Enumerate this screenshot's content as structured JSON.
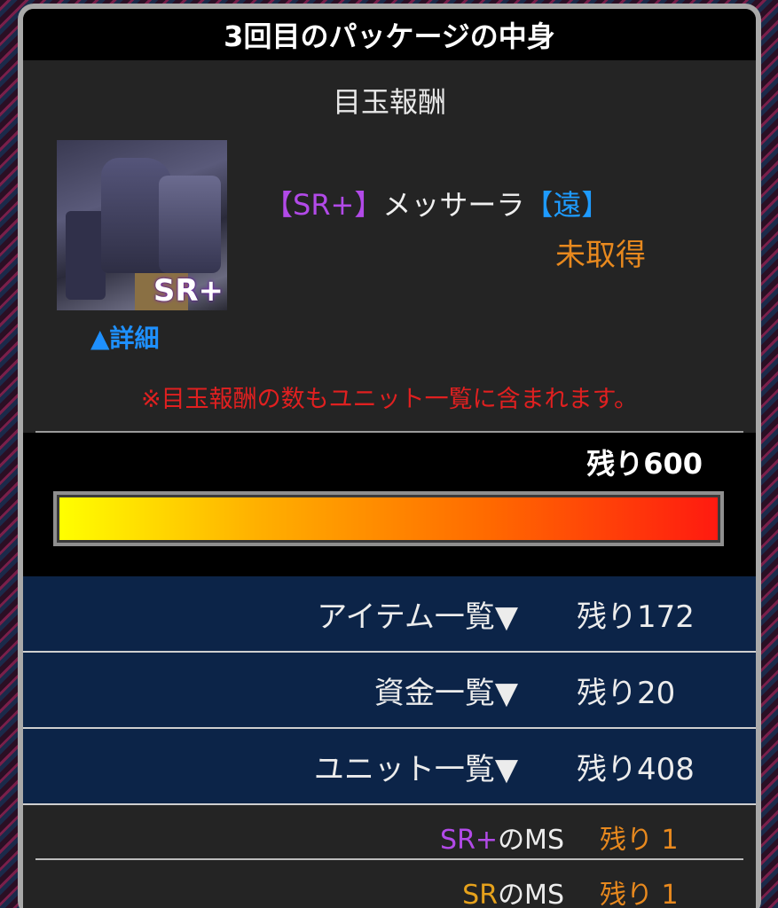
{
  "header": {
    "title": "3回目のパッケージの中身"
  },
  "featured": {
    "section_title": "目玉報酬",
    "thumbnail_badge": "SR+",
    "rarity_tag": "【SR+】",
    "unit_name": "メッサーラ",
    "range_tag": "【遠】",
    "status": "未取得",
    "detail_link": "▲詳細",
    "notice": "※目玉報酬の数もユニット一覧に含まれます。"
  },
  "gauge": {
    "remaining_label": "残り600",
    "remaining_value": 600,
    "fill_fraction": 1.0,
    "gradient_colors": [
      "#ffff00",
      "#ffb000",
      "#ff6a00",
      "#ff1a10"
    ]
  },
  "lists": [
    {
      "label": "アイテム一覧▼",
      "remaining": "残り172"
    },
    {
      "label": "資金一覧▼",
      "remaining": "残り20"
    },
    {
      "label": "ユニット一覧▼",
      "remaining": "残り408"
    }
  ],
  "ms_rows": [
    {
      "rarity": "SR+",
      "suffix": "のMS",
      "remaining": "残り 1",
      "rarity_color": "#b24ae8"
    },
    {
      "rarity": "SR",
      "suffix": "のMS",
      "remaining": "残り 1",
      "rarity_color": "#e6a21c"
    }
  ],
  "colors": {
    "accent_purple": "#b24ae8",
    "accent_blue": "#1e9bff",
    "status_orange": "#e8891e",
    "notice_red": "#e02020",
    "list_bg": "#0c2448"
  }
}
